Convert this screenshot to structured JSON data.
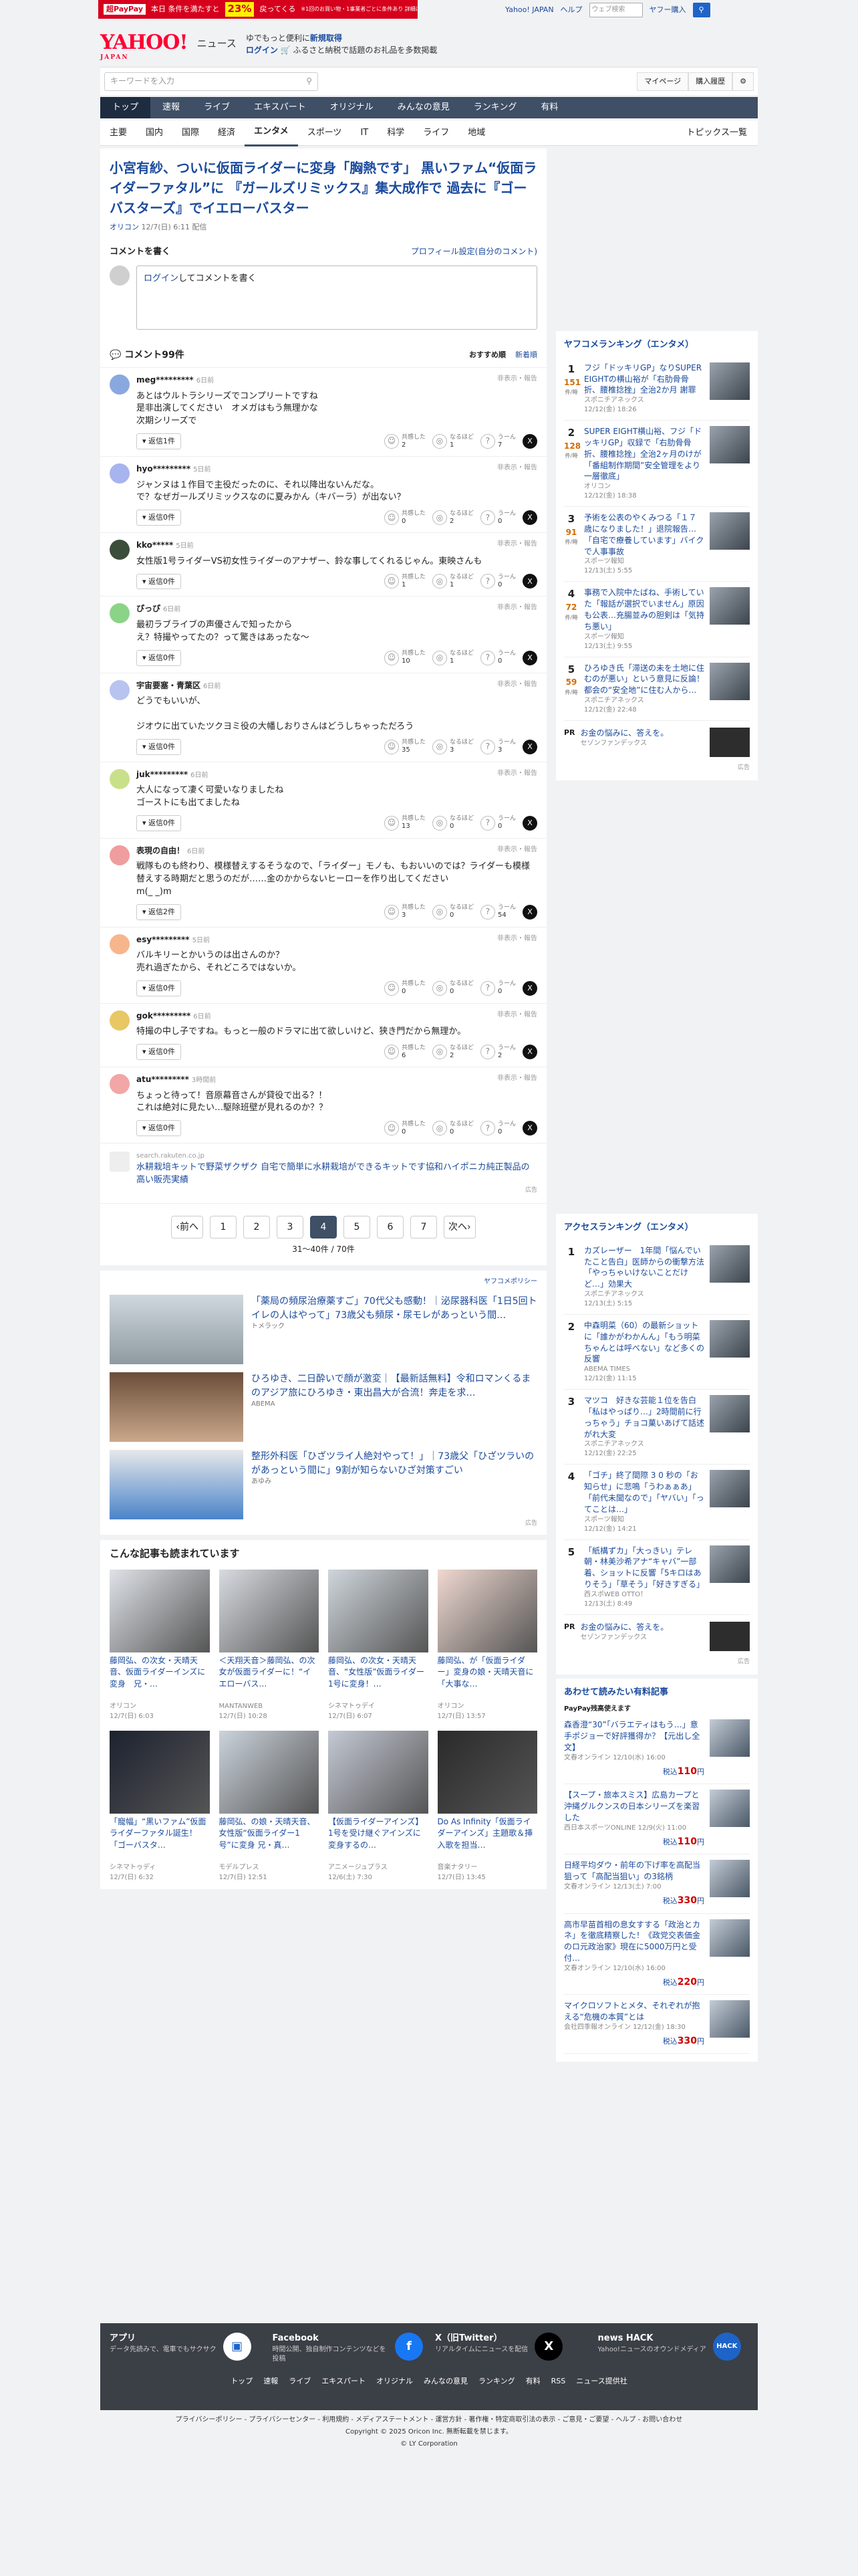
{
  "promo": {
    "tag": "超PayPay",
    "text": "本日 条件を満たすと",
    "big": "23%",
    "suffix": "戻ってくる",
    "note": "※1回のお買い物・1事業者ごとに条件あり 詳細はこちら"
  },
  "util": {
    "yahoo": "Yahoo! JAPAN",
    "help": "ヘルプ",
    "search_placeholder": "ウェブ検索",
    "buy": "ヤフー購入",
    "go": "検索"
  },
  "brand": {
    "logo": "YAHOO!",
    "logo_sub": "JAPAN",
    "news": "ニュース",
    "msg1": "ゆでもっと便利に",
    "msg1_link": "新規取得",
    "msg2_link": "ログイン",
    "msg2": "ふるさと納税で話題のお礼品を多数掲載"
  },
  "tools": {
    "kw_placeholder": "キーワードを入力",
    "mypage": "マイページ",
    "history": "購入履歴"
  },
  "gnav": [
    "トップ",
    "速報",
    "ライブ",
    "エキスパート",
    "オリジナル",
    "みんなの意見",
    "ランキング",
    "有料"
  ],
  "subnav": [
    "主要",
    "国内",
    "国際",
    "経済",
    "エンタメ",
    "スポーツ",
    "IT",
    "科学",
    "ライフ",
    "地域"
  ],
  "topics": "トピックス一覧",
  "article": {
    "title": "小宮有紗、ついに仮面ライダーに変身「胸熱です」 黒いファム“仮面ライダーファタル”に 『ガールズリミックス』集大成作で 過去に『ゴーバスターズ』でイエローバスター",
    "source": "オリコン",
    "date": "12/7(日) 6:11 配信"
  },
  "cform": {
    "title": "コメントを書く",
    "profile": "プロフィール設定(自分のコメント)",
    "login": "ログイン",
    "prompt": "してコメントを書く"
  },
  "clist": {
    "count": "コメント99件",
    "sort_rec": "おすすめ順",
    "sort_new": "新着順"
  },
  "reacts": {
    "a": "共感した",
    "b": "なるほど",
    "c": "うーん"
  },
  "comments": [
    {
      "name": "meg*********",
      "time": "6日前",
      "hide": "非表示・報告",
      "text": "あとはウルトラシリーズでコンプリートですね\n是非出演してください　オメガはもう無理かな\n次期シリーズで",
      "reply": "返信1件",
      "a": "2",
      "b": "1",
      "c": "7"
    },
    {
      "name": "hyo*********",
      "time": "5日前",
      "hide": "非表示・報告",
      "text": "ジャンヌは１作目で主役だったのに、それ以降出ないんだな。\nで？なぜガールズリミックスなのに夏みかん（キバーラ）が出ない？",
      "reply": "返信0件",
      "a": "0",
      "b": "2",
      "c": "0"
    },
    {
      "name": "kko*****",
      "time": "5日前",
      "hide": "非表示・報告",
      "text": "女性版1号ライダーVS初女性ライダーのアナザー、鈴な事してくれるじゃん。東映さんも",
      "reply": "返信0件",
      "a": "1",
      "b": "1",
      "c": "0"
    },
    {
      "name": "ぴっぴ",
      "time": "6日前",
      "hide": "非表示・報告",
      "text": "最初ラブライブの声優さんで知ったから\nえ？特撮やってたの？って驚きはあったな〜",
      "reply": "返信0件",
      "a": "10",
      "b": "1",
      "c": "0"
    },
    {
      "name": "宇宙要塞・青葉区",
      "time": "6日前",
      "hide": "非表示・報告",
      "text": "どうでもいいが、\n\nジオウに出ていたツクヨミ役の大幡しおりさんはどうしちゃっただろう",
      "reply": "返信0件",
      "a": "35",
      "b": "3",
      "c": "3"
    },
    {
      "name": "juk*********",
      "time": "6日前",
      "hide": "非表示・報告",
      "text": "大人になって凄く可愛いなりましたね\nゴーストにも出てましたね",
      "reply": "返信0件",
      "a": "13",
      "b": "0",
      "c": "0"
    },
    {
      "name": "表現の自由！",
      "time": "6日前",
      "hide": "非表示・報告",
      "text": "戦隊ものも終わり、模様替えするそうなので、「ライダー」モノも、もおいいのでは？ライダーも模様替えする時期だと思うのだが……金のかからないヒーローを作り出してください\nm(_ _)m",
      "reply": "返信2件",
      "a": "3",
      "b": "0",
      "c": "54"
    },
    {
      "name": "esy*********",
      "time": "5日前",
      "hide": "非表示・報告",
      "text": "バルキリーとかいうのは出さんのか？\n売れ過ぎたから、それどころではないか。",
      "reply": "返信0件",
      "a": "0",
      "b": "0",
      "c": "0"
    },
    {
      "name": "gok*********",
      "time": "6日前",
      "hide": "非表示・報告",
      "text": "特撮の中し子ですね。もっと一般のドラマに出て欲しいけど、狭き門だから無理か。",
      "reply": "返信0件",
      "a": "6",
      "b": "2",
      "c": "2"
    },
    {
      "name": "atu*********",
      "time": "3時間前",
      "hide": "非表示・報告",
      "text": "ちょっと待って！音原幕音さんが貸役で出る？！\nこれは絶対に見たい…駆除班壁が見れるのか？？",
      "reply": "返信0件",
      "a": "0",
      "b": "0",
      "c": "0"
    }
  ],
  "ad": {
    "src": "search.rakuten.co.jp",
    "text": "水耕栽培キットで野菜ザクザク 自宅で簡単に水耕栽培ができるキットです協和ハイポニカ純正製品の高い販売実績",
    "label": "広告"
  },
  "pager": {
    "prev": "前へ",
    "next": "次へ",
    "pages": [
      "1",
      "2",
      "3",
      "4",
      "5",
      "6",
      "7"
    ],
    "current": "4",
    "info": "31〜40件 / 70件"
  },
  "recs": {
    "policy": "ヤフコメポリシー",
    "items": [
      {
        "t": "「薬局の頻尿治療薬すご」70代父も感動！｜泌尿器科医「1日5回トイレの人はやって」73歳父も頻尿・尿モレがあっという間…",
        "s": "トメラック"
      },
      {
        "t": "ひろゆき、二日酔いで顔が激変｜【最新話無料】令和ロマンくるまのアジア旅にひろゆき・東出昌大が合流！奔走を求…",
        "s": "ABEMA"
      },
      {
        "t": "整形外科医「ひざツライ人絶対やって！」｜73歳父「ひざツラいのがあっという間に」9割が知らないひざ対策すごい",
        "s": "あゆみ"
      }
    ],
    "ad": "広告"
  },
  "read": {
    "title": "こんな記事も読まれています",
    "items": [
      {
        "t": "藤岡弘、の次女・天晴天音、仮面ライダーインズに変身　兄・…",
        "s": "オリコン",
        "d": "12/7(日) 6:03"
      },
      {
        "t": "＜天翔天音＞藤岡弘、の次女が仮面ライダーに！“イエローバス…",
        "s": "MANTANWEB",
        "d": "12/7(日) 10:28"
      },
      {
        "t": "藤岡弘、の次女・天晴天音、“女性版”仮面ライダー1号に変身！…",
        "s": "シネマトゥデイ",
        "d": "12/7(日) 6:07"
      },
      {
        "t": "藤岡弘、が「仮面ライダー」変身の娘・天晴天音に「大事な…",
        "s": "オリコン",
        "d": "12/7(日) 13:57"
      },
      {
        "t": "「寵幅」“黒いファム”仮面ライダーファタル誕生！「ゴーバスタ…",
        "s": "シネマトゥディ",
        "d": "12/7(日) 6:32"
      },
      {
        "t": "藤岡弘、の娘・天晴天音、女性版“仮面ライダー1号”に変身 兄・真…",
        "s": "モデルプレス",
        "d": "12/7(日) 12:51"
      },
      {
        "t": "【仮面ライダーアインズ】1号を受け継ぐアインズに変身するの…",
        "s": "アニメージュプラス",
        "d": "12/6(土) 7:30"
      },
      {
        "t": "Do As Infinity「仮面ライダーアインズ」主題歌＆挿入歌を担当…",
        "s": "音楽ナタリー",
        "d": "12/7(日) 13:45"
      }
    ]
  },
  "rank1": {
    "title": "ヤフコメランキング（エンタメ）",
    "unit": "件/時",
    "items": [
      {
        "no": "1",
        "cnt": "151",
        "t": "フジ「ドッキリGP」なりSUPER EIGHTの横山裕が「右肋骨骨折、腰椎捻挫」全治2か月 謝罪",
        "s": "スポニチアネックス",
        "d": "12/12(金) 18:26"
      },
      {
        "no": "2",
        "cnt": "128",
        "t": "SUPER EIGHT横山裕、フジ「ドッキリGP」収録で「右肋骨骨折、腰椎捻挫」全治2ヶ月のけが「番組制作期間”安全管理をより一層徹底」",
        "s": "オリコン",
        "d": "12/12(金) 18:38"
      },
      {
        "no": "3",
        "cnt": "91",
        "t": "予術を公表のやくみつる「１７歳になりました！」退院報告…「自宅で療養しています」バイクで人事事故",
        "s": "スポーツ報知",
        "d": "12/13(土) 5:55"
      },
      {
        "no": "4",
        "cnt": "72",
        "t": "事務で入院中たばね、手術していた「報話が選択でいません」原因も公表…充腸並みの胆剣は「気持ち悪い」",
        "s": "スポーツ報知",
        "d": "12/13(土) 9:55"
      },
      {
        "no": "5",
        "cnt": "59",
        "t": "ひろゆき氏「滞送の未を土地に住むのが悪い」という意見に反論！都会の“安全地”に住む人から…",
        "s": "スポニチアネックス",
        "d": "12/12(金) 22:48"
      }
    ],
    "pr": "PR",
    "pr_t": "お金の悩みに、答えを。",
    "pr_s": "セゾンファンデックス",
    "ad": "広告"
  },
  "rank2": {
    "title": "アクセスランキング（エンタメ）",
    "items": [
      {
        "no": "1",
        "t": "カズレーザー　1年間「悩んでいたこと告白」医師からの衝撃方法「やっちゃいけないことだけど…」効果大",
        "s": "スポニチアネックス",
        "d": "12/13(土) 5:15"
      },
      {
        "no": "2",
        "t": "中森明菜（60）の最新ショットに「誰かがわかんん」「もう明菜ちゃんとは呼べない」など多くの反響",
        "s": "ABEMA TIMES",
        "d": "12/12(金) 11:15"
      },
      {
        "no": "3",
        "t": "マツコ　好きな芸能１位を告白「私はやっぱり…」2時間前に行っちゃう」チョコ菓いあげて話述がれ大変",
        "s": "スポニチアネックス",
        "d": "12/12(金) 22:25"
      },
      {
        "no": "4",
        "t": "「ゴチ」終了間際 3 0 秒の「お知らせ」に悲鳴「うわぁぁあ」「前代未聞なので」「ヤバい」「ってことは…」",
        "s": "スポーツ報知",
        "d": "12/12(金) 14:21"
      },
      {
        "no": "5",
        "t": "「紙構ずカ」「大っきい」テレ朝・林美沙希アナ“キャバ”一部着、ショットに反響「5キロはありそう」「草そう」「好きすぎる」",
        "s": "西スポWEB OTTO！",
        "d": "12/13(土) 8:49"
      }
    ],
    "pr": "PR",
    "pr_t": "お金の悩みに、答えを。",
    "pr_s": "セゾンファンデックス",
    "ad": "広告"
  },
  "shop": {
    "title": "あわせて読みたい有料記事",
    "paypay": "PayPay残高使えます",
    "items": [
      {
        "t": "森香澄“30”「バラエティはもう…」意手ポジョーで好評獲得か？【元出し全文】",
        "s": "文春オンライン",
        "d": "12/10(水) 16:00",
        "p": "110"
      },
      {
        "t": "【スープ・旅本スミス】広島カープと沖縄グルクンスの日本シリーズを楽習した",
        "s": "西日本スポーツONLINE",
        "d": "12/9(火) 11:00",
        "p": "110"
      },
      {
        "t": "日経平均ダウ・前年の下げ率を高配当狙って「高配当狙い」の3銘柄",
        "s": "文春オンライン",
        "d": "12/13(土) 7:00",
        "p": "330"
      },
      {
        "t": "高市早苗首相の息女すする「政治とカネ」を徹底精察した！《政党交表価金のロ元政治家》現在に5000万円と受付…",
        "s": "文春オンライン",
        "d": "12/10(水) 16:00",
        "p": "220"
      },
      {
        "t": "マイクロソフトとメタ、それぞれが抱える“危機の本質”とは",
        "s": "会社四季報オンライン",
        "d": "12/12(金) 18:30",
        "p": "330"
      }
    ],
    "tax": "税込",
    "yen": "円"
  },
  "footer": {
    "apps": [
      {
        "t": "アプリ",
        "d": "データ先読みで、電車でもサクサク"
      },
      {
        "t": "Facebook",
        "d": "時間公開、独自制作コンテンツなどを投稿"
      },
      {
        "t": "X（旧Twitter）",
        "d": "リアルタイムにニュースを配信"
      },
      {
        "t": "news HACK",
        "d": "Yahoo!ニュースのオウンドメディア"
      }
    ],
    "nav": [
      "トップ",
      "速報",
      "ライブ",
      "エキスパート",
      "オリジナル",
      "みんなの意見",
      "ランキング",
      "有料",
      "RSS",
      "ニュース提供社"
    ],
    "links": "プライバシーポリシー - プライバシーセンター - 利用規約 - メディアステートメント - 運営方針 - 著作権・特定商取引法の表示 - ご意見・ご要望 - ヘルプ - お問い合わせ",
    "copy": "Copyright © 2025 Oricon Inc. 無断転載を禁じます。",
    "corp": "© LY Corporation"
  }
}
